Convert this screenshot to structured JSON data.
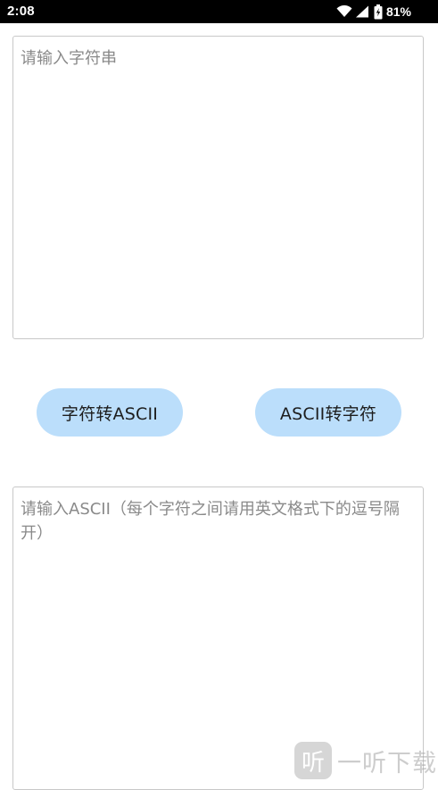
{
  "status_bar": {
    "time": "2:08",
    "battery": "81%",
    "icons": [
      "wifi-icon",
      "cell-signal-icon",
      "battery-icon"
    ]
  },
  "string_input": {
    "placeholder": "请输入字符串",
    "value": ""
  },
  "buttons": {
    "to_ascii": "字符转ASCII",
    "to_string": "ASCII转字符"
  },
  "ascii_input": {
    "placeholder": "请输入ASCII（每个字符之间请用英文格式下的逗号隔开）",
    "value": ""
  },
  "watermark": {
    "logo_glyph": "听",
    "text": "一听下载"
  },
  "colors": {
    "button_bg": "#bbdefb",
    "status_bar_bg": "#000000",
    "placeholder": "#8a8a8a"
  }
}
